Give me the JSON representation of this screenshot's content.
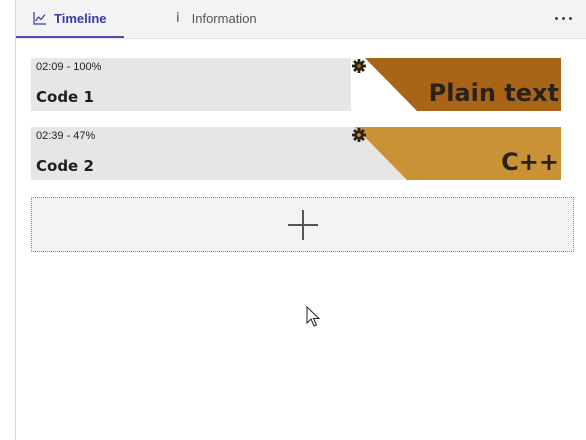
{
  "tabs": {
    "timeline_label": "Timeline",
    "information_label": "Information",
    "information_icon": "i"
  },
  "toolbar": {
    "more_icon": "more-dots-icon"
  },
  "codes": [
    {
      "meta": "02:09 - 100%",
      "title": "Code 1",
      "language": "Plain text",
      "color": "#a86417",
      "icon": "gear-icon"
    },
    {
      "meta": "02:39 - 47%",
      "title": "Code 2",
      "language": "C++",
      "color": "#ca9236",
      "icon": "gear-icon"
    }
  ],
  "add_button": {
    "icon": "plus-icon"
  },
  "colors": {
    "accent": "#4f4cb8",
    "card_bg": "#e6e6e6"
  }
}
